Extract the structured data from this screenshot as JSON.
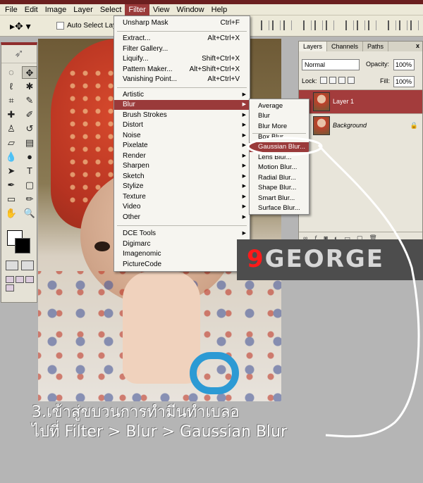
{
  "menubar": {
    "items": [
      "File",
      "Edit",
      "Image",
      "Layer",
      "Select",
      "Filter",
      "View",
      "Window",
      "Help"
    ],
    "active": "Filter"
  },
  "options_bar": {
    "auto_select_label": "Auto Select Layer"
  },
  "filter_menu": {
    "group1": [
      {
        "label": "Unsharp Mask",
        "shortcut": "Ctrl+F"
      }
    ],
    "group2": [
      {
        "label": "Extract...",
        "shortcut": "Alt+Ctrl+X"
      },
      {
        "label": "Filter Gallery...",
        "shortcut": ""
      },
      {
        "label": "Liquify...",
        "shortcut": "Shift+Ctrl+X"
      },
      {
        "label": "Pattern Maker...",
        "shortcut": "Alt+Shift+Ctrl+X"
      },
      {
        "label": "Vanishing Point...",
        "shortcut": "Alt+Ctrl+V"
      }
    ],
    "group3": [
      "Artistic",
      "Blur",
      "Brush Strokes",
      "Distort",
      "Noise",
      "Pixelate",
      "Render",
      "Sharpen",
      "Sketch",
      "Stylize",
      "Texture",
      "Video",
      "Other"
    ],
    "group4": [
      "DCE Tools",
      "Digimarc",
      "Imagenomic",
      "PictureCode"
    ],
    "highlighted": "Blur"
  },
  "blur_menu": {
    "group1": [
      "Average",
      "Blur",
      "Blur More"
    ],
    "group2": [
      "Box Blur...",
      "Gaussian Blur...",
      "Lens Blur...",
      "Motion Blur...",
      "Radial Blur...",
      "Shape Blur...",
      "Smart Blur...",
      "Surface Blur..."
    ],
    "highlighted": "Gaussian Blur..."
  },
  "layers_panel": {
    "tabs": [
      "Layers",
      "Channels",
      "Paths"
    ],
    "close_label": "x",
    "blend_mode": "Normal",
    "opacity_label": "Opacity:",
    "opacity_value": "100%",
    "lock_label": "Lock:",
    "fill_label": "Fill:",
    "fill_value": "100%",
    "layers": [
      {
        "name": "Layer 1",
        "selected": true
      },
      {
        "name": "Background",
        "selected": false
      }
    ]
  },
  "watermark": {
    "lead": "9",
    "rest": "GEORGE"
  },
  "caption": {
    "line1": "3.เข้าสู่ขบวนการทำมีนทำเบลอ",
    "line2": "ไปที่ Filter > Blur > Gaussian Blur"
  },
  "colors": {
    "highlight": "#9a3a3a",
    "watermark_red": "#ff1a1a"
  }
}
